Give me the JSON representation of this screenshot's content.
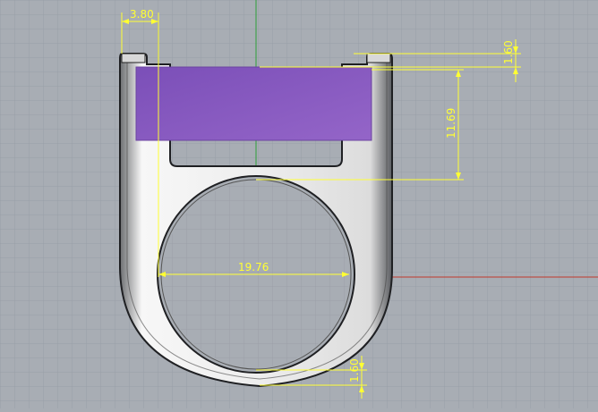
{
  "viewport": {
    "grid_color": "#9aa0a8",
    "background": "#a8adb4",
    "x_axis_color": "#c0392b",
    "y_axis_color": "#2e9e3a"
  },
  "ring": {
    "gem_color": "#8a5cc0",
    "band_color": "#f2f2f2"
  },
  "dimensions": {
    "top_width": "3.80",
    "top_thickness": "1.60",
    "height": "11.69",
    "inner_diameter": "19.76",
    "bottom_thickness": "1.60",
    "color": "#ffff33"
  }
}
